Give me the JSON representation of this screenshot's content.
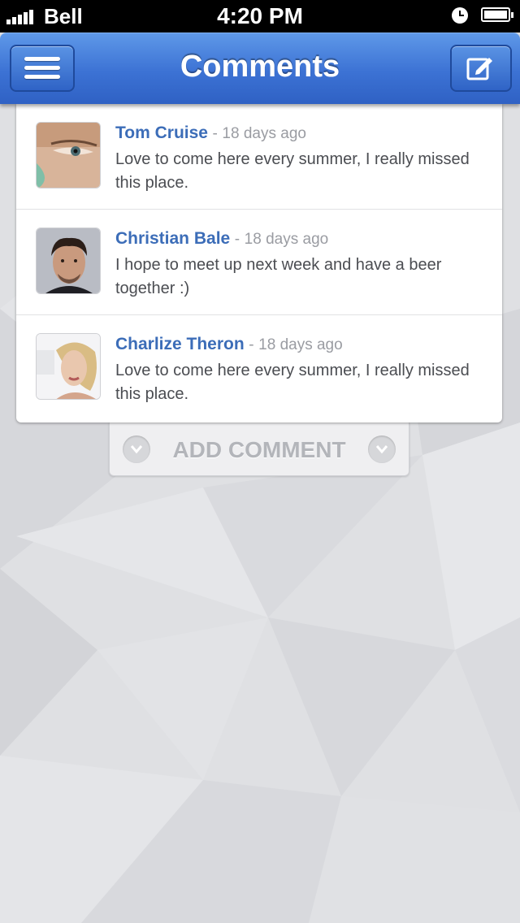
{
  "status_bar": {
    "carrier": "Bell",
    "time": "4:20 PM"
  },
  "nav": {
    "title": "Comments",
    "left_icon": "hamburger-menu-icon",
    "right_icon": "compose-icon"
  },
  "comments": [
    {
      "author": "Tom Cruise",
      "separator": "-",
      "time": "18 days ago",
      "text": "Love to come here every summer, I really missed this place."
    },
    {
      "author": "Christian Bale",
      "separator": "-",
      "time": "18 days ago",
      "text": "I hope to meet up next week and have a beer together :)"
    },
    {
      "author": "Charlize Theron",
      "separator": "-",
      "time": "18 days ago",
      "text": "Love to come here every summer, I really missed this place."
    }
  ],
  "add_comment": {
    "label": "ADD COMMENT",
    "icon": "chevron-down-icon"
  },
  "colors": {
    "nav_blue": "#3c72d4",
    "author_blue": "#3c6db8",
    "background": "#dcdde0"
  }
}
